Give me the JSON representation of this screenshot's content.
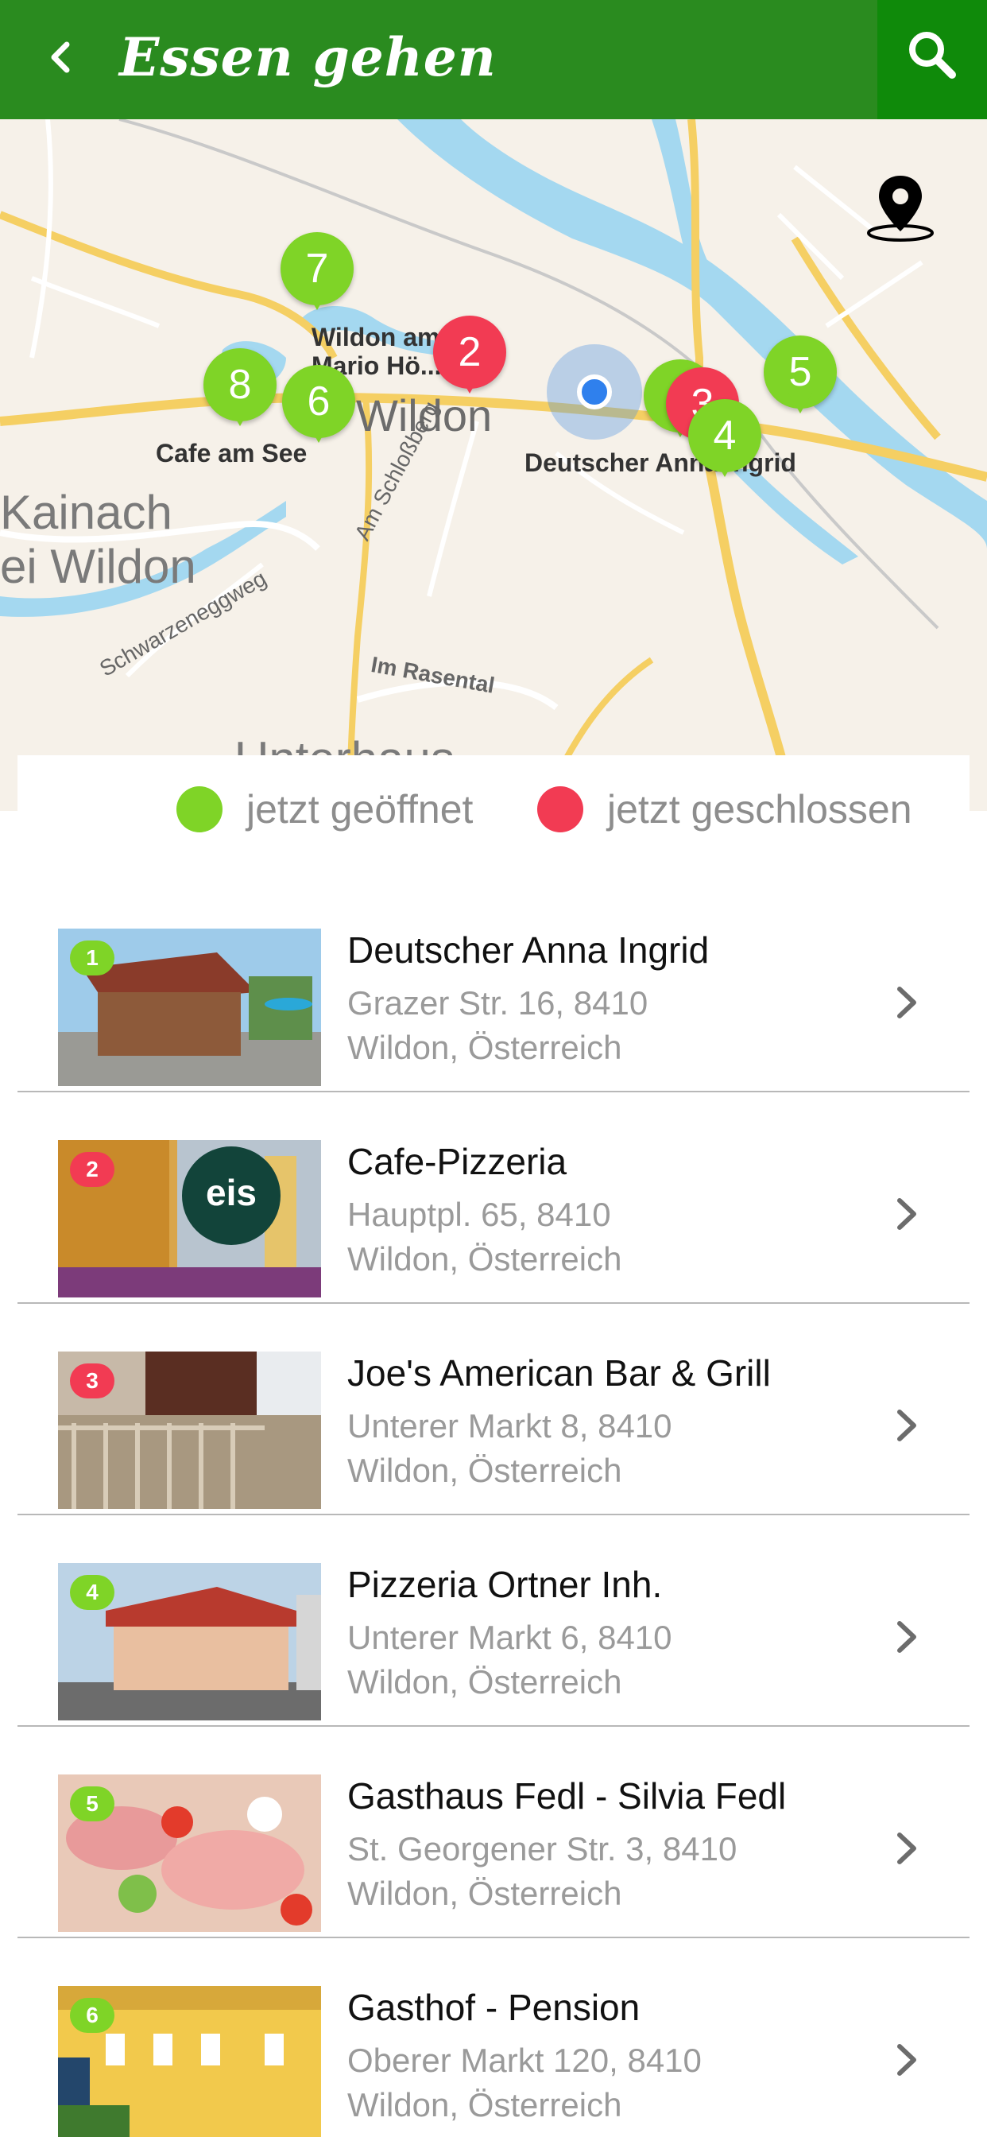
{
  "header": {
    "title": "Essen gehen",
    "back_icon": "chevron-left-icon",
    "search_icon": "search-icon",
    "bar_color": "#2a8b1f",
    "search_bg_color": "#0f8a0a"
  },
  "map": {
    "labels": {
      "wildon": "Wildon",
      "kainach": "Kainach",
      "bei_wildon": "ei Wildon",
      "cafe_am_see": "Cafe am See",
      "wildon_am_see_1": "Wildon am See,",
      "wildon_am_see_2": "Mario Hö...sser",
      "deutscher": "Deutscher Anna Ingrid",
      "am_schlossberg": "Am Schloßberg",
      "schwarzeneggweg": "Schwarzeneggweg",
      "im_rasental": "Im Rasental",
      "unterhaus": "Unterhaus"
    },
    "markers": [
      {
        "num": "7",
        "status": "open"
      },
      {
        "num": "2",
        "status": "closed"
      },
      {
        "num": "8",
        "status": "open"
      },
      {
        "num": "6",
        "status": "open"
      },
      {
        "num": "1",
        "status": "open"
      },
      {
        "num": "3",
        "status": "closed"
      },
      {
        "num": "4",
        "status": "open"
      },
      {
        "num": "5",
        "status": "open"
      }
    ],
    "location_icon": "location-pin-icon"
  },
  "legend": {
    "open_label": "jetzt geöffnet",
    "closed_label": "jetzt geschlossen",
    "open_color": "#7fd427",
    "closed_color": "#f23b53"
  },
  "restaurants": [
    {
      "num": "1",
      "status": "open",
      "name": "Deutscher Anna Ingrid",
      "address_line1": "Grazer Str. 16, 8410",
      "address_line2": "Wildon, Österreich"
    },
    {
      "num": "2",
      "status": "closed",
      "name": "Cafe-Pizzeria",
      "address_line1": "Hauptpl. 65, 8410",
      "address_line2": "Wildon, Österreich"
    },
    {
      "num": "3",
      "status": "closed",
      "name": "Joe's American Bar & Grill",
      "address_line1": "Unterer Markt 8, 8410",
      "address_line2": "Wildon, Österreich"
    },
    {
      "num": "4",
      "status": "open",
      "name": "Pizzeria Ortner Inh.",
      "address_line1": "Unterer Markt 6, 8410",
      "address_line2": "Wildon, Österreich"
    },
    {
      "num": "5",
      "status": "open",
      "name": "Gasthaus Fedl - Silvia Fedl",
      "address_line1": "St. Georgener Str. 3, 8410",
      "address_line2": "Wildon, Österreich"
    },
    {
      "num": "6",
      "status": "open",
      "name": "Gasthof - Pension",
      "address_line1": "Oberer Markt 120, 8410",
      "address_line2": "Wildon, Österreich"
    }
  ],
  "row_chevron_icon": "chevron-right-icon"
}
